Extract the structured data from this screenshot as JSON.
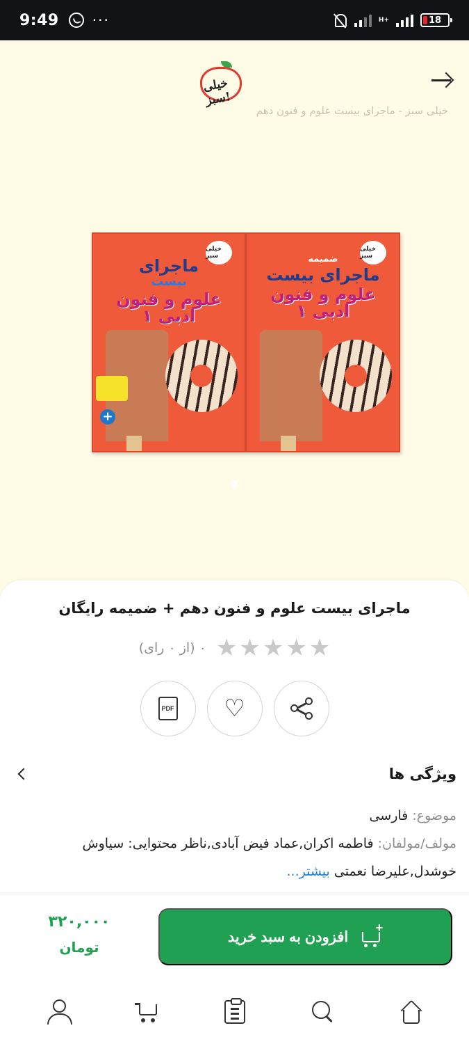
{
  "status_bar": {
    "time": "9:49",
    "notification_icons": [
      "whatsapp-icon",
      "more-dots-icon"
    ],
    "more_dots": "···",
    "network_label": "H+",
    "battery_level": "18"
  },
  "hero": {
    "logo_text": "خیلی سبز!",
    "faded_caption": "خیلی سبز - ماجرای بیست علوم و فنون دهم",
    "images_count": 1,
    "active_image": 1,
    "book_left": {
      "logo": "خیلی سبز",
      "line1": "ماجرای",
      "line2": "بیست",
      "line3": "علوم و فنون ادبی ۱"
    },
    "book_right": {
      "logo": "خیلی سبز",
      "line1": "ضمیمه",
      "line2": "ماجرای بیست",
      "line3": "علوم و فنون ادبی ۱"
    }
  },
  "product": {
    "title": "ماجرای بیست علوم و فنون دهم + ضمیمه رایگان",
    "rating_text": "۰ (از ۰ رای)",
    "rating_value": 0,
    "rating_max": 5,
    "actions": {
      "share_icon": "share-icon",
      "wishlist_icon": "heart-icon",
      "pdf_icon": "pdf-icon",
      "pdf_label": "PDF",
      "heart_glyph": "♡"
    }
  },
  "features": {
    "title": "ویژگی ها",
    "subject_key": "موضوع:",
    "subject_value": "فارسی",
    "authors_key": "مولف/مولفان:",
    "authors_value": "فاطمه اکران,عماد فیض آبادی,ناظر محتوایی: سیاوش خوشدل,علیرضا نعمتی",
    "more_link": "بیشتر..."
  },
  "purchase": {
    "add_to_cart_label": "افزودن به سبد خرید",
    "price_value": "۳۲۰,۰۰۰",
    "price_currency": "تومان",
    "accent_color": "#1fa053"
  },
  "bottom_nav": {
    "items": [
      "profile-icon",
      "cart-icon",
      "orders-icon",
      "search-icon",
      "home-icon"
    ]
  },
  "colors": {
    "hero_background": "#fefbe6",
    "primary_green": "#1fa053",
    "link_blue": "#1f7ed9",
    "star_empty": "#c9c9c9"
  }
}
